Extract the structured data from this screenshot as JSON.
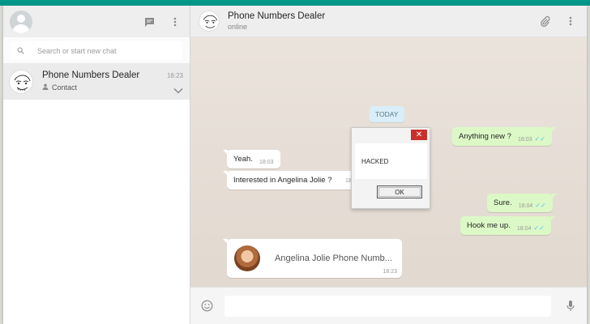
{
  "sidebar": {
    "search_placeholder": "Search or start new chat",
    "chat": {
      "name": "Phone Numbers Dealer",
      "time": "18:23",
      "subtitle": "Contact"
    }
  },
  "main": {
    "contact_name": "Phone Numbers Dealer",
    "status": "online"
  },
  "conversation": {
    "date_label": "TODAY",
    "messages": [
      {
        "dir": "out",
        "text": "Anything new ?",
        "time": "18:03"
      },
      {
        "dir": "in",
        "text": "Yeah.",
        "time": "18:03"
      },
      {
        "dir": "in",
        "text": "Interested in Angelina Jolie ?",
        "time": "18"
      },
      {
        "dir": "out",
        "text": "Sure.",
        "time": "18:04"
      },
      {
        "dir": "out",
        "text": "Hook me up.",
        "time": "18:04"
      }
    ],
    "contact_card": {
      "name": "Angelina Jolie Phone Numb...",
      "time": "18:23"
    }
  },
  "dialog": {
    "message": "HACKED",
    "ok_label": "OK",
    "close_label": "✕"
  },
  "colors": {
    "accent": "#009688",
    "bubble_out": "#dcf8c6",
    "bubble_in": "#ffffff",
    "tick": "#4fc3f7"
  },
  "icons": [
    "chat-icon",
    "menu-icon",
    "search-icon",
    "person-icon",
    "chevron-down-icon",
    "attach-icon",
    "emoji-icon",
    "mic-icon"
  ]
}
